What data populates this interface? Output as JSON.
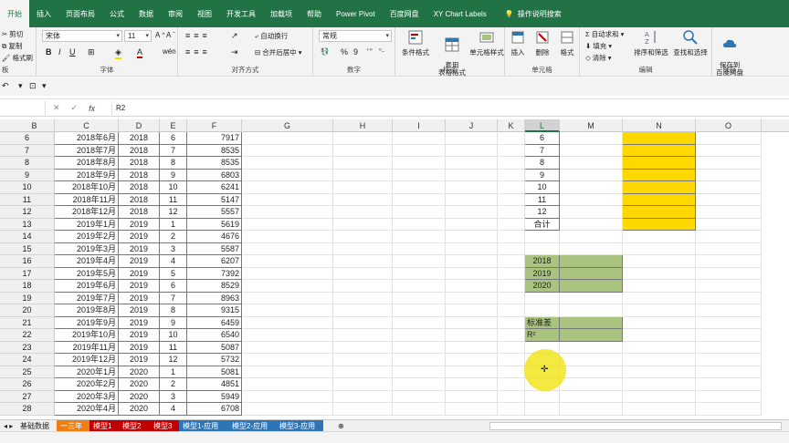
{
  "ribbon_tabs": [
    "开始",
    "插入",
    "页面布局",
    "公式",
    "数据",
    "审阅",
    "视图",
    "开发工具",
    "加载项",
    "帮助",
    "Power Pivot",
    "百度网盘",
    "XY Chart Labels"
  ],
  "tell_me": "操作说明搜索",
  "clipboard": {
    "cut": "剪切",
    "copy": "复制",
    "painter": "格式刷",
    "label": "板"
  },
  "font": {
    "name": "宋体",
    "size": "11",
    "label": "字体",
    "bold": "B",
    "italic": "I",
    "underline": "U"
  },
  "alignment": {
    "wrap": "自动换行",
    "merge": "合并后居中",
    "label": "对齐方式"
  },
  "number": {
    "format": "常规",
    "label": "数字",
    "percent": "%",
    "comma": "9"
  },
  "styles": {
    "conditional": "条件格式",
    "table": "套用\n表格格式",
    "cell": "单元格样式",
    "label": "样式"
  },
  "cells": {
    "insert": "插入",
    "delete": "删除",
    "format": "格式",
    "label": "单元格"
  },
  "editing": {
    "autosum": "自动求和",
    "fill": "填充",
    "clear": "清除",
    "sort": "排序和筛选",
    "find": "查找和选择",
    "label": "编辑"
  },
  "save": {
    "to_baidu": "保存到\n百度网盘",
    "label": "保存"
  },
  "formula_bar": {
    "name_box": "",
    "fx": "fx",
    "content": "R2"
  },
  "columns": [
    "B",
    "C",
    "D",
    "E",
    "F",
    "G",
    "H",
    "I",
    "J",
    "K",
    "L",
    "M",
    "N",
    "O"
  ],
  "selected_column": "L",
  "rows": [
    {
      "n": "6",
      "c": "2018年6月",
      "d": "2018",
      "e": "6",
      "f": "7917"
    },
    {
      "n": "7",
      "c": "2018年7月",
      "d": "2018",
      "e": "7",
      "f": "8535"
    },
    {
      "n": "8",
      "c": "2018年8月",
      "d": "2018",
      "e": "8",
      "f": "8535"
    },
    {
      "n": "9",
      "c": "2018年9月",
      "d": "2018",
      "e": "9",
      "f": "6803"
    },
    {
      "n": "10",
      "c": "2018年10月",
      "d": "2018",
      "e": "10",
      "f": "6241"
    },
    {
      "n": "11",
      "c": "2018年11月",
      "d": "2018",
      "e": "11",
      "f": "5147"
    },
    {
      "n": "12",
      "c": "2018年12月",
      "d": "2018",
      "e": "12",
      "f": "5557"
    },
    {
      "n": "13",
      "c": "2019年1月",
      "d": "2019",
      "e": "1",
      "f": "5619"
    },
    {
      "n": "14",
      "c": "2019年2月",
      "d": "2019",
      "e": "2",
      "f": "4676"
    },
    {
      "n": "15",
      "c": "2019年3月",
      "d": "2019",
      "e": "3",
      "f": "5587"
    },
    {
      "n": "16",
      "c": "2019年4月",
      "d": "2019",
      "e": "4",
      "f": "6207"
    },
    {
      "n": "17",
      "c": "2019年5月",
      "d": "2019",
      "e": "5",
      "f": "7392"
    },
    {
      "n": "18",
      "c": "2019年6月",
      "d": "2019",
      "e": "6",
      "f": "8529"
    },
    {
      "n": "19",
      "c": "2019年7月",
      "d": "2019",
      "e": "7",
      "f": "8963"
    },
    {
      "n": "20",
      "c": "2019年8月",
      "d": "2019",
      "e": "8",
      "f": "9315"
    },
    {
      "n": "21",
      "c": "2019年9月",
      "d": "2019",
      "e": "9",
      "f": "6459"
    },
    {
      "n": "22",
      "c": "2019年10月",
      "d": "2019",
      "e": "10",
      "f": "6540"
    },
    {
      "n": "23",
      "c": "2019年11月",
      "d": "2019",
      "e": "11",
      "f": "5087"
    },
    {
      "n": "24",
      "c": "2019年12月",
      "d": "2019",
      "e": "12",
      "f": "5732"
    },
    {
      "n": "25",
      "c": "2020年1月",
      "d": "2020",
      "e": "1",
      "f": "5081"
    },
    {
      "n": "26",
      "c": "2020年2月",
      "d": "2020",
      "e": "2",
      "f": "4851"
    },
    {
      "n": "27",
      "c": "2020年3月",
      "d": "2020",
      "e": "3",
      "f": "5949"
    },
    {
      "n": "28",
      "c": "2020年4月",
      "d": "2020",
      "e": "4",
      "f": "6708"
    }
  ],
  "l_column": [
    "6",
    "7",
    "8",
    "9",
    "10",
    "11",
    "12",
    "合计",
    "",
    "",
    "2018",
    "2019",
    "2020",
    "",
    "",
    "标准差",
    "R²",
    "",
    "",
    "",
    "",
    "",
    ""
  ],
  "sheet_tabs": [
    {
      "name": "基础数据",
      "color": "#f0f0f0",
      "text": "#222"
    },
    {
      "name": "一三年",
      "color": "#f07f12",
      "text": "#fff"
    },
    {
      "name": "模型1",
      "color": "#c00000",
      "text": "#fff"
    },
    {
      "name": "模型2",
      "color": "#c00000",
      "text": "#fff"
    },
    {
      "name": "模型3",
      "color": "#c00000",
      "text": "#fff"
    },
    {
      "name": "模型1-应用",
      "color": "#2e75b6",
      "text": "#fff"
    },
    {
      "name": "模型2-应用",
      "color": "#2e75b6",
      "text": "#fff"
    },
    {
      "name": "模型3-应用",
      "color": "#2e75b6",
      "text": "#fff"
    }
  ],
  "colors": {
    "brand": "#217346",
    "yellow_fill": "#ffd800",
    "green_fill": "#a9c47f"
  }
}
